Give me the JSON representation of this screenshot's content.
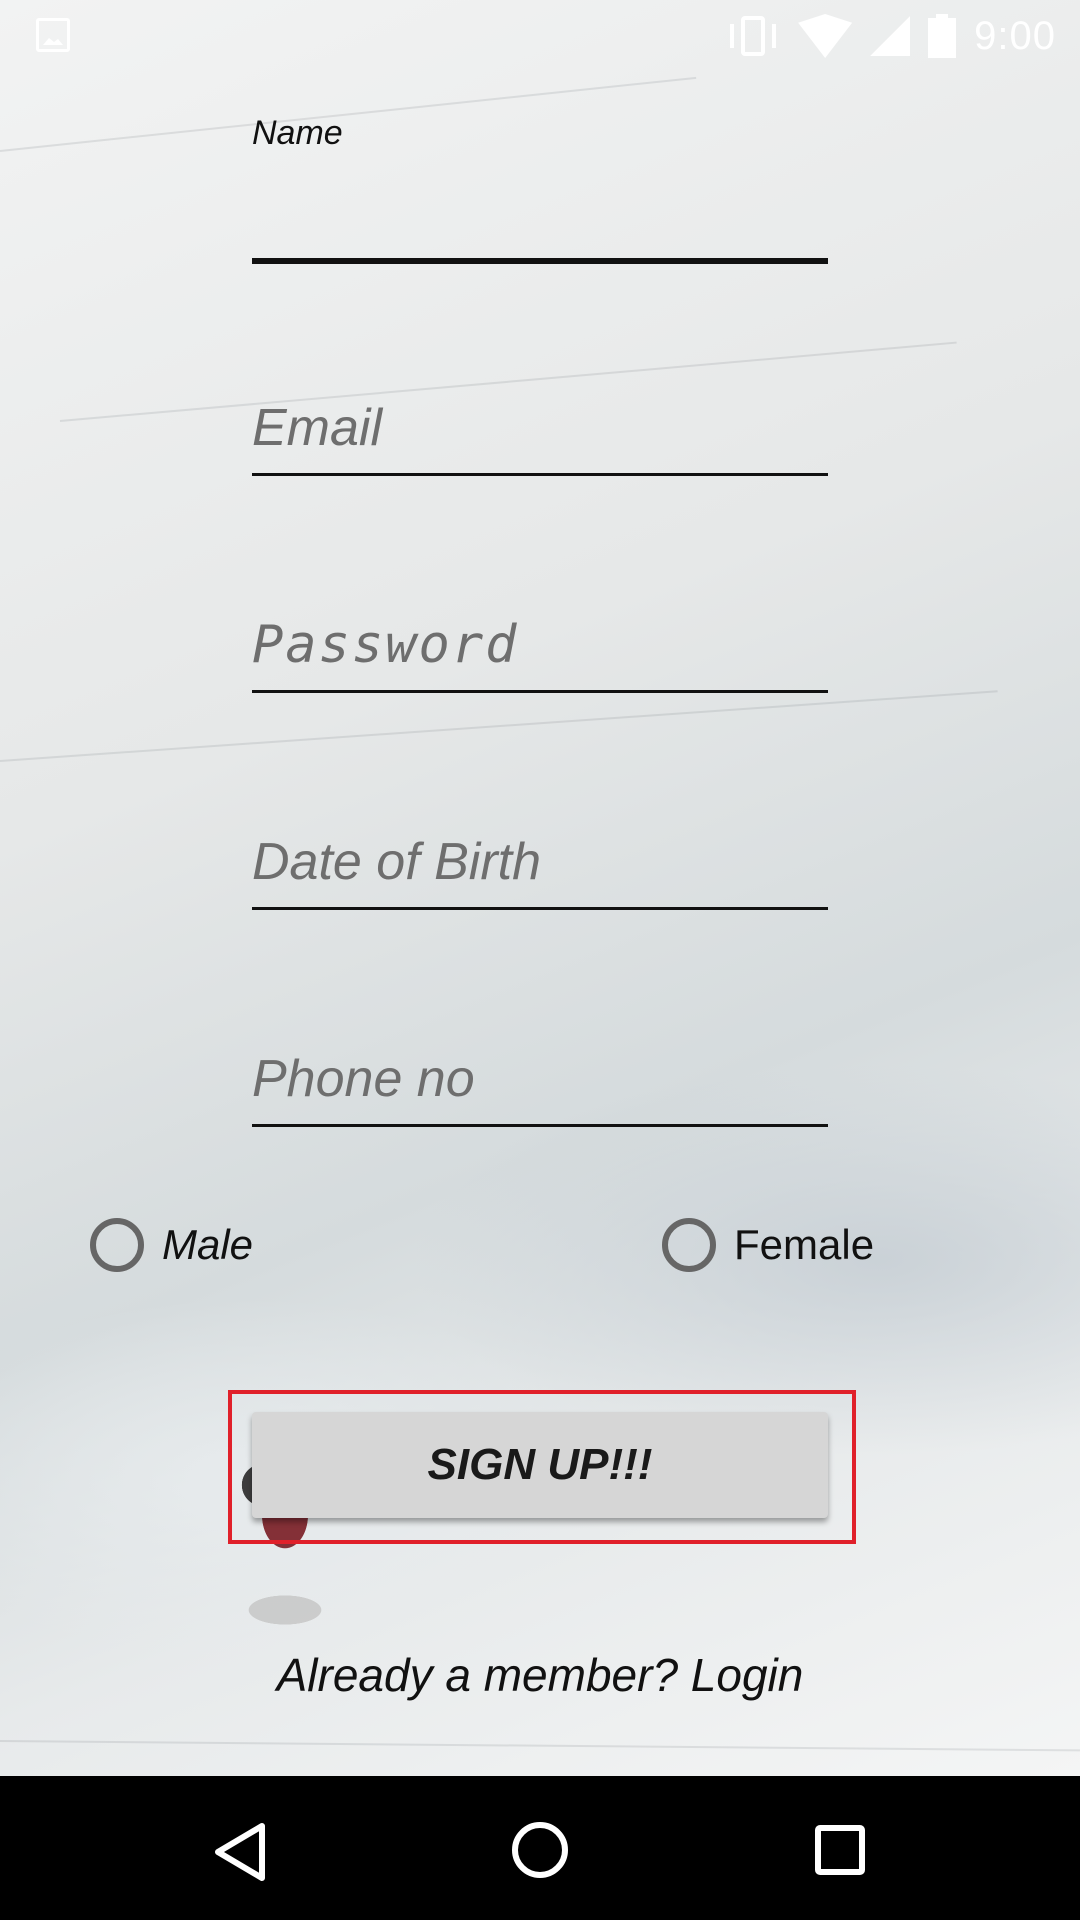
{
  "status_bar": {
    "time": "9:00",
    "icons": [
      "image-icon",
      "vibrate-icon",
      "wifi-icon",
      "signal-icon",
      "battery-icon"
    ]
  },
  "form": {
    "name_label": "Name",
    "name_value": "",
    "email_placeholder": "Email",
    "password_placeholder": "Password",
    "dob_placeholder": "Date of Birth",
    "phone_placeholder": "Phone no",
    "gender_options": [
      "Male",
      "Female"
    ],
    "signup_label": "SIGN UP!!!",
    "login_text": "Already a member? Login"
  },
  "nav_bar": {
    "icons": [
      "back-icon",
      "home-icon",
      "recents-icon"
    ]
  },
  "colors": {
    "highlight": "#e0202a",
    "button_bg": "#d6d6d6",
    "nav_bg": "#000000"
  }
}
